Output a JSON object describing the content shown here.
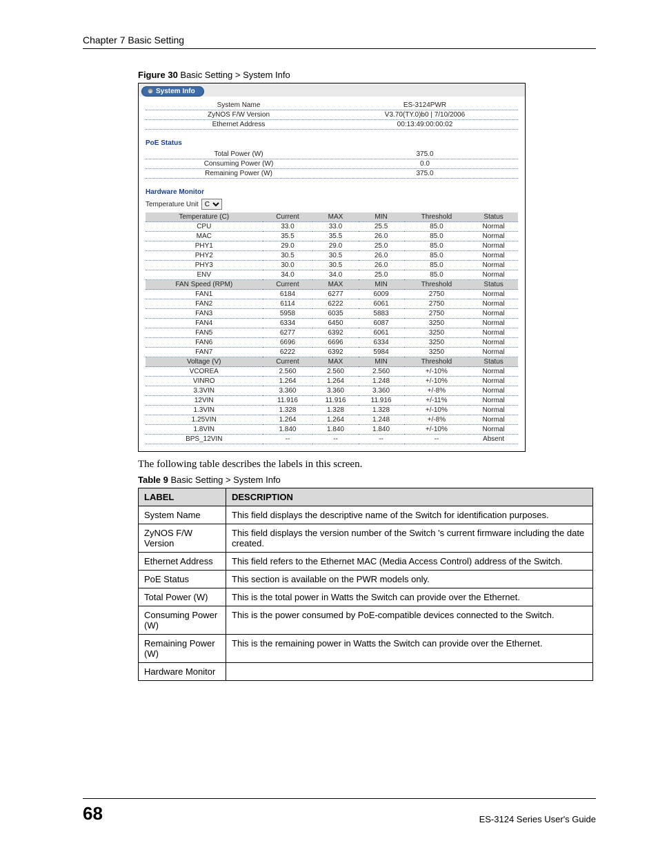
{
  "chapter": "Chapter 7 Basic Setting",
  "figureCaption": {
    "prefix": "Figure 30",
    "text": "   Basic Setting > System Info"
  },
  "screenshot": {
    "tabTitle": "System Info",
    "sysRows": [
      {
        "label": "System Name",
        "value": "ES-3124PWR"
      },
      {
        "label": "ZyNOS F/W Version",
        "value": "V3.70(TY.0)b0 | 7/10/2006"
      },
      {
        "label": "Ethernet Address",
        "value": "00:13:49:00:00:02"
      }
    ],
    "poeTitle": "PoE Status",
    "poeRows": [
      {
        "label": "Total Power (W)",
        "value": "375.0"
      },
      {
        "label": "Consuming Power (W)",
        "value": "0.0"
      },
      {
        "label": "Remaining Power (W)",
        "value": "375.0"
      }
    ],
    "hwTitle": "Hardware Monitor",
    "tempUnitLabel": "Temperature Unit",
    "tempUnitValue": "C",
    "tempHeader": [
      "Temperature (C)",
      "Current",
      "MAX",
      "MIN",
      "Threshold",
      "Status"
    ],
    "tempRows": [
      [
        "CPU",
        "33.0",
        "33.0",
        "25.5",
        "85.0",
        "Normal"
      ],
      [
        "MAC",
        "35.5",
        "35.5",
        "26.0",
        "85.0",
        "Normal"
      ],
      [
        "PHY1",
        "29.0",
        "29.0",
        "25.0",
        "85.0",
        "Normal"
      ],
      [
        "PHY2",
        "30.5",
        "30.5",
        "26.0",
        "85.0",
        "Normal"
      ],
      [
        "PHY3",
        "30.0",
        "30.5",
        "26.0",
        "85.0",
        "Normal"
      ],
      [
        "ENV",
        "34.0",
        "34.0",
        "25.0",
        "85.0",
        "Normal"
      ]
    ],
    "fanHeader": [
      "FAN Speed (RPM)",
      "Current",
      "MAX",
      "MIN",
      "Threshold",
      "Status"
    ],
    "fanRows": [
      [
        "FAN1",
        "6184",
        "6277",
        "6009",
        "2750",
        "Normal"
      ],
      [
        "FAN2",
        "6114",
        "6222",
        "6061",
        "2750",
        "Normal"
      ],
      [
        "FAN3",
        "5958",
        "6035",
        "5883",
        "2750",
        "Normal"
      ],
      [
        "FAN4",
        "6334",
        "6450",
        "6087",
        "3250",
        "Normal"
      ],
      [
        "FAN5",
        "6277",
        "6392",
        "6061",
        "3250",
        "Normal"
      ],
      [
        "FAN6",
        "6696",
        "6696",
        "6334",
        "3250",
        "Normal"
      ],
      [
        "FAN7",
        "6222",
        "6392",
        "5984",
        "3250",
        "Normal"
      ]
    ],
    "voltHeader": [
      "Voltage (V)",
      "Current",
      "MAX",
      "MIN",
      "Threshold",
      "Status"
    ],
    "voltRows": [
      [
        "VCOREA",
        "2.560",
        "2.560",
        "2.560",
        "+/-10%",
        "Normal"
      ],
      [
        "VINRO",
        "1.264",
        "1.264",
        "1.248",
        "+/-10%",
        "Normal"
      ],
      [
        "3.3VIN",
        "3.360",
        "3.360",
        "3.360",
        "+/-8%",
        "Normal"
      ],
      [
        "12VIN",
        "11.916",
        "11.916",
        "11.916",
        "+/-11%",
        "Normal"
      ],
      [
        "1.3VIN",
        "1.328",
        "1.328",
        "1.328",
        "+/-10%",
        "Normal"
      ],
      [
        "1.25VIN",
        "1.264",
        "1.264",
        "1.248",
        "+/-8%",
        "Normal"
      ],
      [
        "1.8VIN",
        "1.840",
        "1.840",
        "1.840",
        "+/-10%",
        "Normal"
      ],
      [
        "BPS_12VIN",
        "--",
        "--",
        "--",
        "--",
        "Absent"
      ]
    ]
  },
  "bodyText": "The following table describes the labels in this screen.",
  "tableCaption": {
    "prefix": "Table 9",
    "text": "   Basic Setting > System Info"
  },
  "descTable": {
    "headers": [
      "LABEL",
      "DESCRIPTION"
    ],
    "rows": [
      [
        "System Name",
        "This field displays the descriptive name of the Switch for identification purposes."
      ],
      [
        "ZyNOS F/W Version",
        "This field displays the version number of the Switch 's current firmware including the date created."
      ],
      [
        "Ethernet Address",
        "This field refers to the Ethernet MAC (Media Access Control) address of the Switch."
      ],
      [
        "PoE Status",
        "This section is available on the PWR models only."
      ],
      [
        "Total Power (W)",
        "This is the total power in Watts the Switch can provide over the Ethernet."
      ],
      [
        "Consuming Power (W)",
        "This is the power consumed by PoE-compatible devices connected to the Switch."
      ],
      [
        "Remaining Power (W)",
        "This is the remaining power in Watts the Switch can provide over the Ethernet."
      ],
      [
        "Hardware Monitor",
        ""
      ]
    ]
  },
  "footer": {
    "pageNum": "68",
    "guide": "ES-3124 Series User's Guide"
  }
}
